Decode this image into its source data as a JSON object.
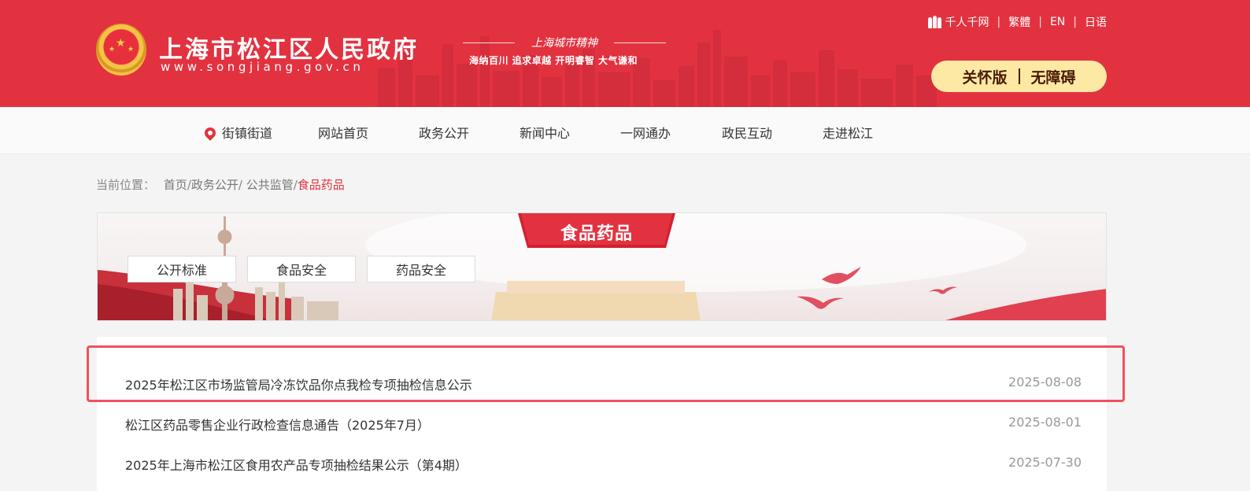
{
  "header": {
    "site_title": "上海市松江区人民政府",
    "site_url": "www.songjiang.gov.cn",
    "slogan_title": "上海城市精神",
    "slogan": "海纳百川  追求卓越  开明睿智  大气谦和",
    "top_links": {
      "qianren": "千人千网",
      "traditional": "繁體",
      "english": "EN",
      "japanese": "日语"
    },
    "access": {
      "care": "关怀版",
      "barrier_free": "无障碍"
    }
  },
  "nav": {
    "items": [
      "街镇街道",
      "网站首页",
      "政务公开",
      "新闻中心",
      "一网通办",
      "政民互动",
      "走进松江"
    ]
  },
  "breadcrumb": {
    "label": "当前位置：",
    "home": "首页",
    "level2": "政务公开",
    "level3": " 公共监管",
    "current": "食品药品",
    "sep": "/"
  },
  "banner": {
    "title": "食品药品",
    "tabs": [
      "公开标准",
      "食品安全",
      "药品安全"
    ]
  },
  "list": [
    {
      "title": "2025年松江区市场监管局冷冻饮品你点我检专项抽检信息公示",
      "date": "2025-08-08"
    },
    {
      "title": "松江区药品零售企业行政检查信息通告（2025年7月）",
      "date": "2025-08-01"
    },
    {
      "title": "2025年上海市松江区食用农产品专项抽检结果公示（第4期）",
      "date": "2025-07-30"
    }
  ],
  "colors": {
    "brand_red": "#e23240",
    "access_bg": "#fde9a4",
    "highlight": "#f0505f"
  }
}
